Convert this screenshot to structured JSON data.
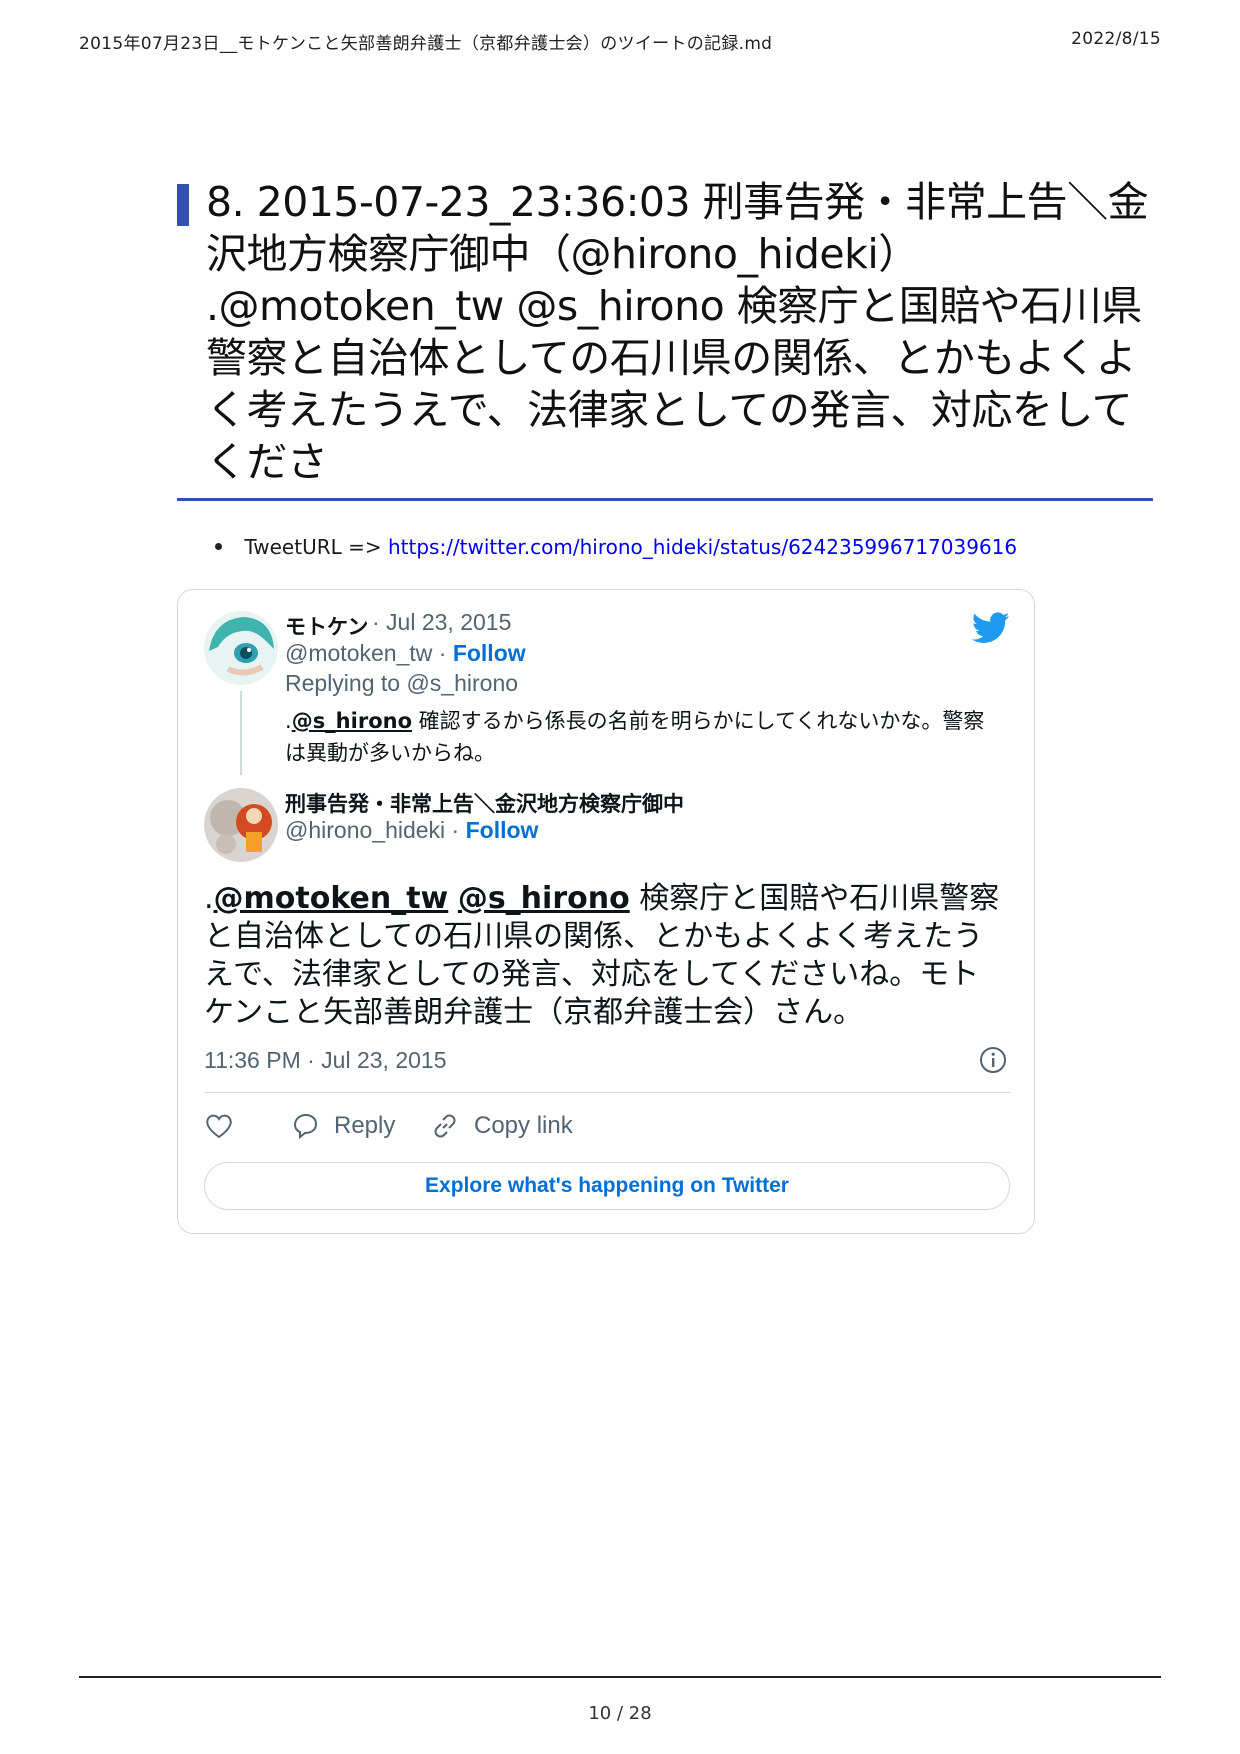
{
  "header": {
    "doc_title": "2015年07月23日__モトケンこと矢部善朗弁護士（京都弁護士会）のツイートの記録.md",
    "date": "2022/8/15"
  },
  "section": {
    "heading": "8. 2015-07-23_23:36:03 刑事告発・非常上告＼金沢地方検察庁御中（@hirono_hideki） .@motoken_tw @s_hirono 検察庁と国賠や石川県警察と自治体としての石川県の関係、とかもよくよく考えたうえで、法律家としての発言、対応をしてくださ"
  },
  "bullet": {
    "label": "TweetURL => ",
    "url": "https://twitter.com/hirono_hideki/status/624235996717039616"
  },
  "tweet": {
    "parent": {
      "display_name": "モトケン",
      "date": "· Jul 23, 2015",
      "handle": "@motoken_tw",
      "follow_sep": " · ",
      "follow": "Follow",
      "replying_to": "Replying to @s_hirono",
      "text_prefix": ".",
      "text_mention": "@s_hirono",
      "text_body": " 確認するから係長の名前を明らかにしてくれないかな。警察は異動が多いからね。"
    },
    "main": {
      "display_name": "刑事告発・非常上告＼金沢地方検察庁御中",
      "handle": "@hirono_hideki",
      "follow_sep": " · ",
      "follow": "Follow",
      "text_prefix": ".",
      "mention_1": "@motoken_tw",
      "space": " ",
      "mention_2": "@s_hirono",
      "text_body": " 検察庁と国賠や石川県警察と自治体としての石川県の関係、とかもよくよく考えたうえで、法律家としての発言、対応をしてくださいね。モトケンこと矢部善朗弁護士（京都弁護士会）さん。",
      "timestamp": "11:36 PM · Jul 23, 2015"
    },
    "actions": {
      "reply": "Reply",
      "copy_link": "Copy link"
    },
    "explore": "Explore what's happening on Twitter"
  },
  "footer": {
    "page": "10 / 28"
  },
  "colors": {
    "accent": "#3451b2",
    "twitter_blue": "#1d9bf0",
    "link": "#006fd6"
  }
}
